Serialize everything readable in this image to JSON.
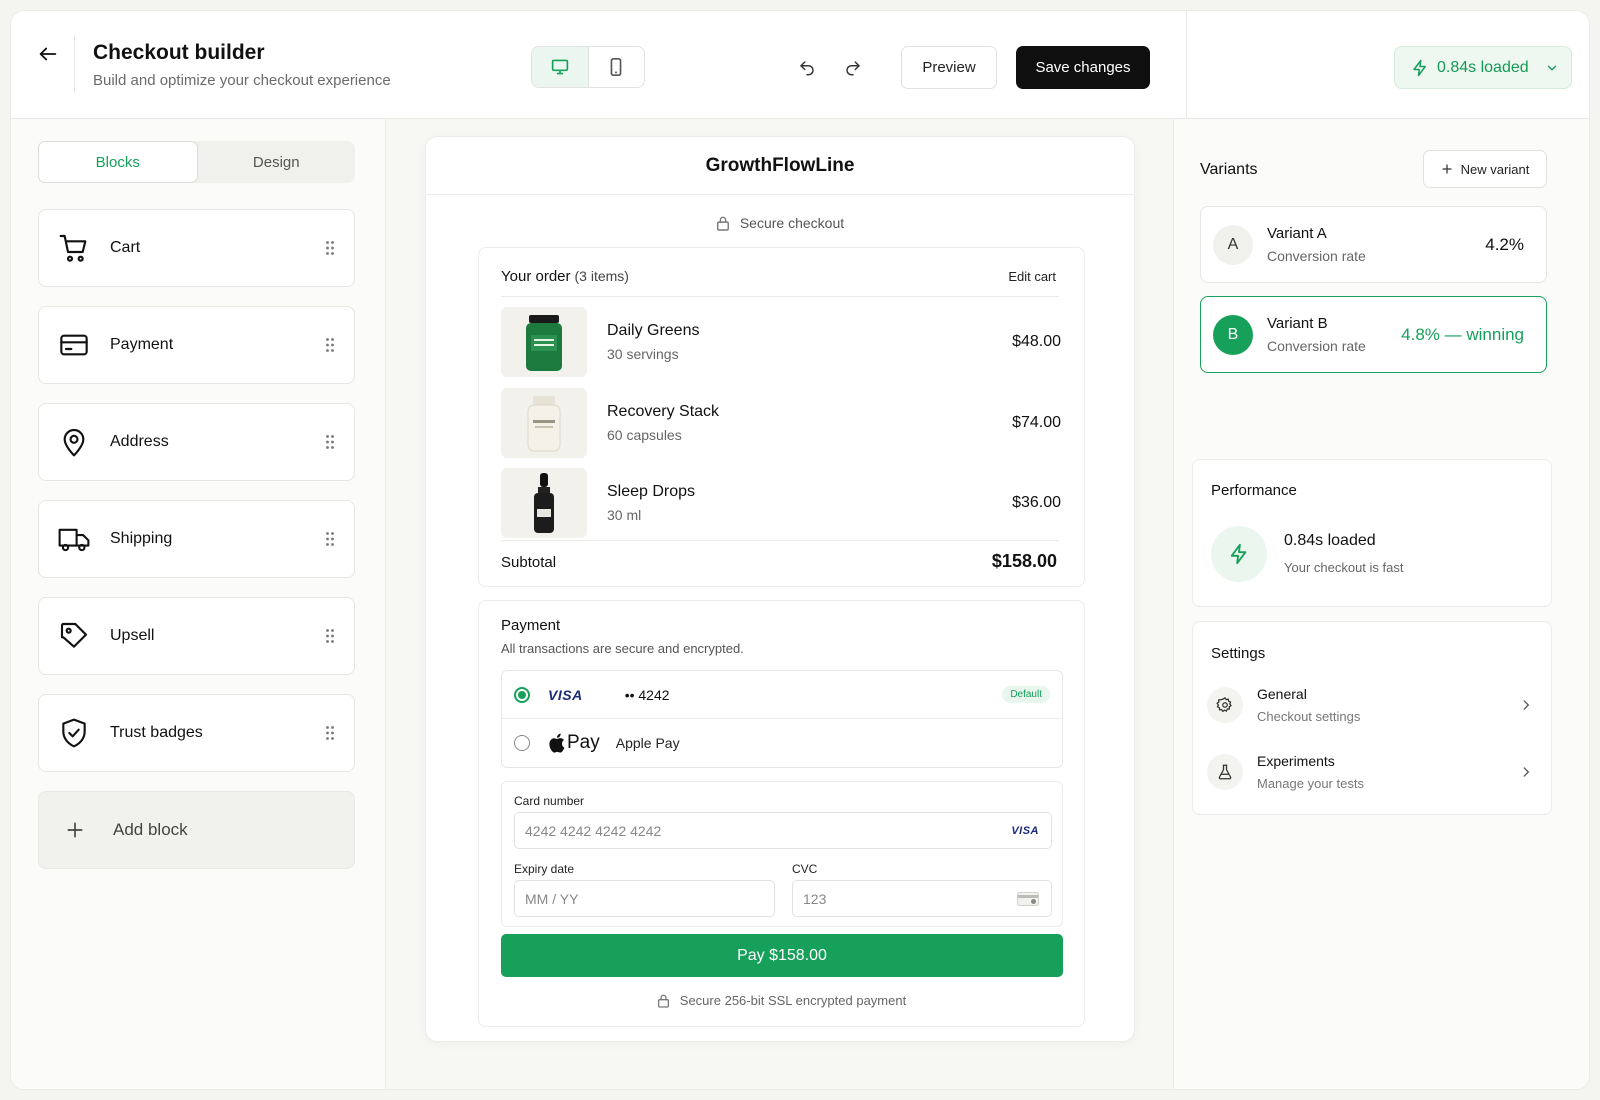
{
  "header": {
    "title": "Checkout builder",
    "subtitle": "Build and optimize your checkout experience",
    "preview_label": "Preview",
    "save_label": "Save changes",
    "loaded_label": "0.84s loaded"
  },
  "sidebar": {
    "tabs": [
      {
        "label": "Blocks",
        "active": true
      },
      {
        "label": "Design",
        "active": false
      }
    ],
    "blocks": [
      {
        "label": "Cart",
        "icon": "cart-icon"
      },
      {
        "label": "Payment",
        "icon": "credit-card-icon"
      },
      {
        "label": "Address",
        "icon": "map-pin-icon"
      },
      {
        "label": "Shipping",
        "icon": "truck-icon"
      },
      {
        "label": "Upsell",
        "icon": "tag-icon"
      },
      {
        "label": "Trust badges",
        "icon": "shield-check-icon"
      }
    ],
    "add_block_label": "Add block"
  },
  "checkout": {
    "brand": "GrowthFlowLine",
    "secure_label": "Secure checkout",
    "order_title": "Your order",
    "order_count": "(3 items)",
    "edit_cart": "Edit cart",
    "items": [
      {
        "name": "Daily Greens",
        "sub": "30 servings",
        "price": "$48.00"
      },
      {
        "name": "Recovery Stack",
        "sub": "60 capsules",
        "price": "$74.00"
      },
      {
        "name": "Sleep Drops",
        "sub": "30 ml",
        "price": "$36.00"
      }
    ],
    "subtotal_label": "Subtotal",
    "subtotal_value": "$158.00",
    "payment_title": "Payment",
    "payment_sub": "All transactions are secure and encrypted.",
    "card_brand": "VISA",
    "card_last4": "•• 4242",
    "default_badge": "Default",
    "apple_pay_mark": "Pay",
    "apple_pay_label": "Apple Pay",
    "card_number_label": "Card number",
    "card_number_placeholder": "4242 4242 4242 4242",
    "expiry_label": "Expiry date",
    "expiry_placeholder": "MM / YY",
    "cvc_label": "CVC",
    "cvc_placeholder": "123",
    "pay_button": "Pay $158.00",
    "ssl_label": "Secure 256-bit SSL encrypted payment"
  },
  "variants": {
    "title": "Variants",
    "new_label": "New variant",
    "items": [
      {
        "letter": "A",
        "name": "Variant A",
        "sub": "Conversion rate",
        "rate": "4.2%",
        "winning": false
      },
      {
        "letter": "B",
        "name": "Variant B",
        "sub": "Conversion rate",
        "rate": "4.8% — winning",
        "winning": true
      }
    ]
  },
  "performance": {
    "title": "Performance",
    "main": "0.84s loaded",
    "sub": "Your checkout is fast"
  },
  "settings": {
    "title": "Settings",
    "items": [
      {
        "name": "General",
        "sub": "Checkout settings",
        "icon": "gear-icon"
      },
      {
        "name": "Experiments",
        "sub": "Manage your tests",
        "icon": "flask-icon"
      }
    ]
  },
  "colors": {
    "accent": "#16a05a",
    "dark": "#0f0f0f",
    "visa": "#1a2b78"
  }
}
